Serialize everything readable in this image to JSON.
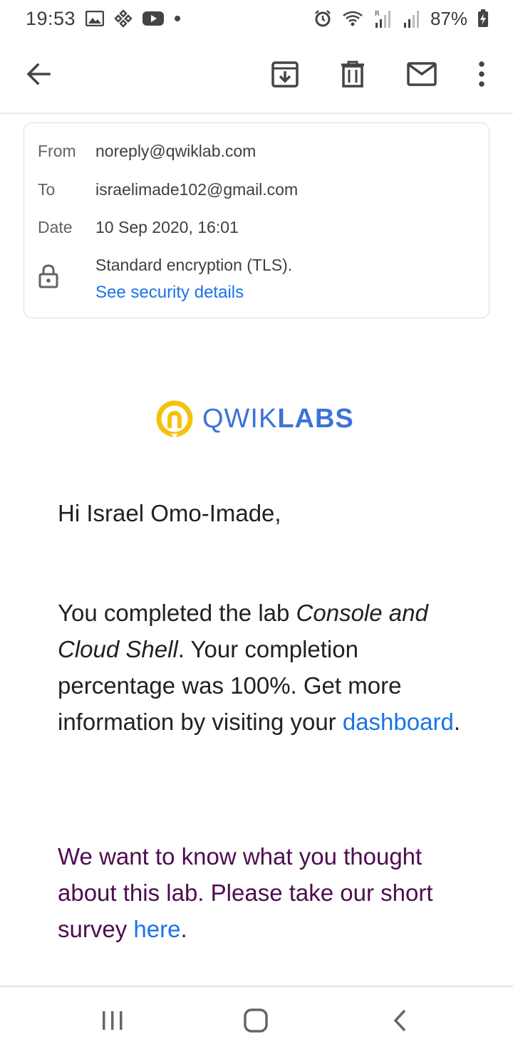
{
  "status_bar": {
    "time": "19:53",
    "battery": "87%",
    "icons": [
      "image-icon",
      "binance-icon",
      "youtube-icon",
      "dot-icon",
      "alarm-icon",
      "wifi-icon",
      "signal-r-icon",
      "signal-icon",
      "battery-charging-icon"
    ]
  },
  "toolbar": {
    "icons": [
      "back-arrow-icon",
      "archive-icon",
      "delete-icon",
      "mail-icon",
      "more-vert-icon"
    ]
  },
  "details": {
    "from_label": "From",
    "from_value": "noreply@qwiklab.com",
    "to_label": "To",
    "to_value": "israelimade102@gmail.com",
    "date_label": "Date",
    "date_value": "10 Sep 2020, 16:01",
    "encryption": "Standard encryption (TLS).",
    "security_link": "See security details"
  },
  "logo": {
    "text_light": "QWIK",
    "text_bold": "LABS",
    "colors": {
      "ring": "#f4c20d",
      "text": "#3b73d9"
    }
  },
  "email": {
    "greeting": "Hi Israel Omo-Imade,",
    "p1_a": "You completed the lab ",
    "p1_em": "Console and Cloud Shell",
    "p1_b": ". Your completion percentage was 100%. Get more information by visiting your ",
    "p1_link": "dashboard",
    "p1_end": ".",
    "p2_a": "We want to know what you thought about this lab. Please take our short survey ",
    "p2_link": "here",
    "p2_end": "."
  },
  "colors": {
    "link": "#1a73e8",
    "survey_text": "#4c0d50"
  },
  "nav_bar": {
    "icons": [
      "recent-apps-icon",
      "home-icon",
      "back-icon"
    ]
  }
}
